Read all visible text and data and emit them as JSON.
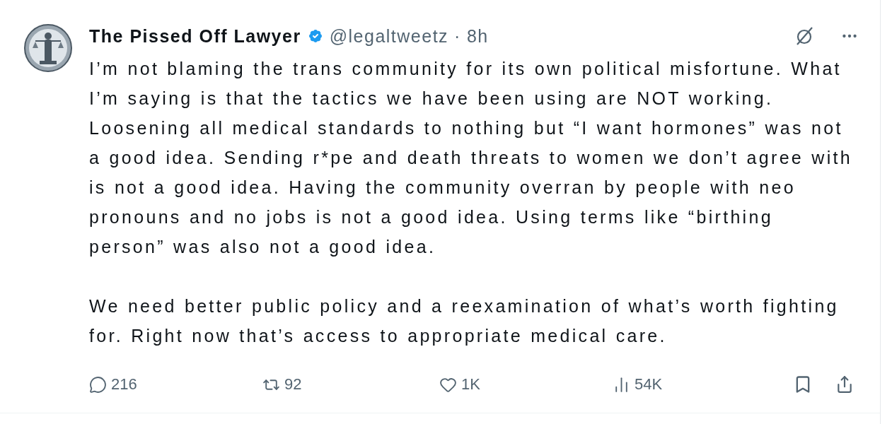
{
  "post": {
    "author_name": "The Pissed Off Lawyer",
    "verified": true,
    "handle": "@legaltweetz",
    "separator": "·",
    "time": "8h",
    "paragraphs": [
      "I’m not blaming the trans community for its own political misfortune. What I’m saying is that the tactics we have been using are NOT working. Loosening all medical standards to nothing but “I want hormones” was not a good idea. Sending r*pe and death threats to women we don’t agree with is not a good idea. Having the community overran by people with neo pronouns and no jobs is not a good idea. Using terms like “birthing person” was also not a good idea.",
      "We need better public policy and a reexamination of what’s worth fighting for. Right now that’s access to appropriate medical care."
    ],
    "actions": [
      {
        "kind": "reply",
        "count": "216"
      },
      {
        "kind": "repost",
        "count": "92"
      },
      {
        "kind": "like",
        "count": "1K"
      },
      {
        "kind": "views",
        "count": "54K"
      }
    ]
  }
}
